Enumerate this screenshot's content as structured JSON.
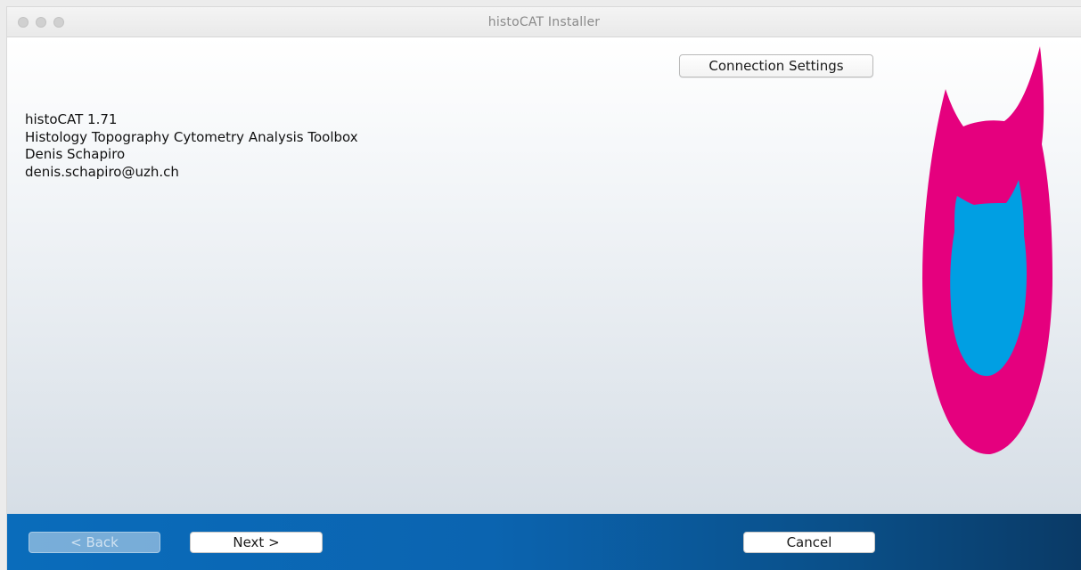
{
  "window": {
    "title": "histoCAT Installer"
  },
  "header": {
    "connection_settings_label": "Connection Settings"
  },
  "info": {
    "lines": [
      "histoCAT 1.71",
      "Histology Topography Cytometry Analysis Toolbox",
      "Denis Schapiro",
      "denis.schapiro@uzh.ch"
    ]
  },
  "logo": {
    "icon": "histocat-logo-icon",
    "outer_color": "#e5007e",
    "inner_color": "#009fe3"
  },
  "footer": {
    "back_label": "< Back",
    "next_label": "Next >",
    "cancel_label": "Cancel",
    "back_enabled": false
  },
  "colors": {
    "footer_accent": "#0b64b0",
    "footer_dark": "#0a3a66"
  }
}
